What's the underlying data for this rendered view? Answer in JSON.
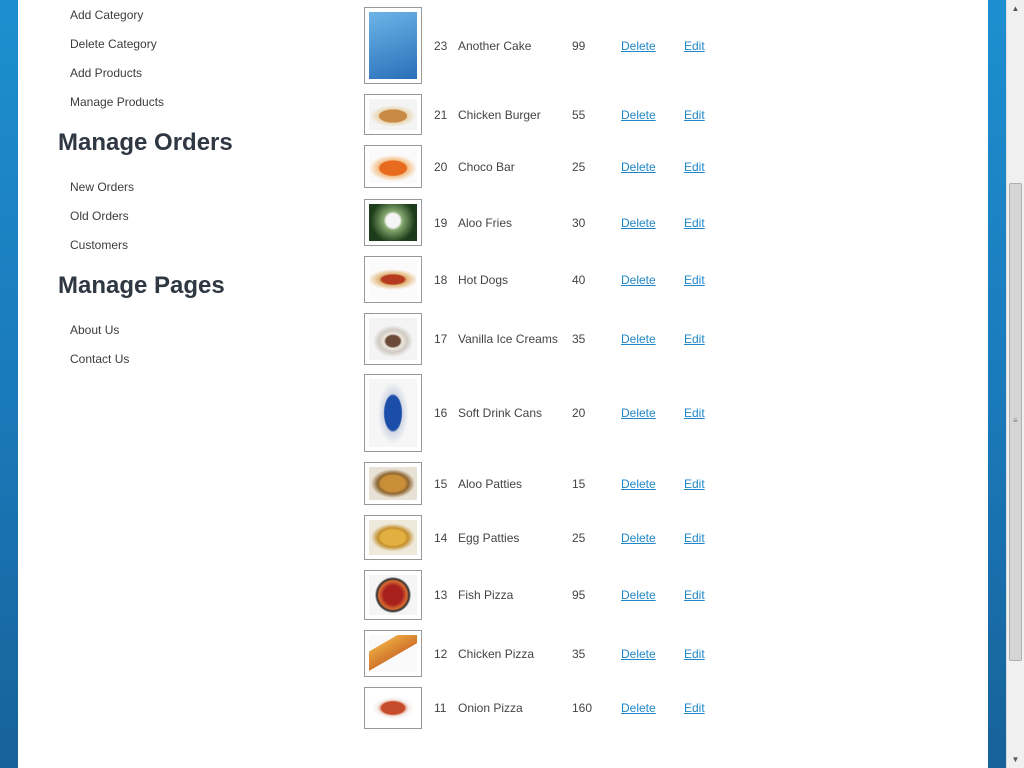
{
  "sidebar": {
    "menu1": [
      {
        "label": "Add Category"
      },
      {
        "label": "Delete Category"
      },
      {
        "label": "Add Products"
      },
      {
        "label": "Manage Products"
      }
    ],
    "orders_title": "Manage Orders",
    "orders": [
      {
        "label": "New Orders"
      },
      {
        "label": "Old Orders"
      },
      {
        "label": "Customers"
      }
    ],
    "pages_title": "Manage Pages",
    "pages": [
      {
        "label": "About Us"
      },
      {
        "label": "Contact Us"
      }
    ]
  },
  "products": [
    {
      "id": "23",
      "name": "Another Cake",
      "price": "99",
      "image": "book-cover",
      "delete_label": "Delete",
      "edit_label": "Edit"
    },
    {
      "id": "21",
      "name": "Chicken Burger",
      "price": "55",
      "image": "burger",
      "delete_label": "Delete",
      "edit_label": "Edit"
    },
    {
      "id": "20",
      "name": "Choco Bar",
      "price": "25",
      "image": "fries",
      "delete_label": "Delete",
      "edit_label": "Edit"
    },
    {
      "id": "19",
      "name": "Aloo Fries",
      "price": "30",
      "image": "flower",
      "delete_label": "Delete",
      "edit_label": "Edit"
    },
    {
      "id": "18",
      "name": "Hot Dogs",
      "price": "40",
      "image": "hotdog",
      "delete_label": "Delete",
      "edit_label": "Edit"
    },
    {
      "id": "17",
      "name": "Vanilla Ice Creams",
      "price": "35",
      "image": "ice-cream",
      "delete_label": "Delete",
      "edit_label": "Edit"
    },
    {
      "id": "16",
      "name": "Soft Drink Cans",
      "price": "20",
      "image": "soda-can",
      "delete_label": "Delete",
      "edit_label": "Edit"
    },
    {
      "id": "15",
      "name": "Aloo Patties",
      "price": "15",
      "image": "patty",
      "delete_label": "Delete",
      "edit_label": "Edit"
    },
    {
      "id": "14",
      "name": "Egg Patties",
      "price": "25",
      "image": "egg-patty",
      "delete_label": "Delete",
      "edit_label": "Edit"
    },
    {
      "id": "13",
      "name": "Fish Pizza",
      "price": "95",
      "image": "pizza",
      "delete_label": "Delete",
      "edit_label": "Edit"
    },
    {
      "id": "12",
      "name": "Chicken Pizza",
      "price": "35",
      "image": "pizza-slice",
      "delete_label": "Delete",
      "edit_label": "Edit"
    },
    {
      "id": "11",
      "name": "Onion Pizza",
      "price": "160",
      "image": "plate-pizza",
      "delete_label": "Delete",
      "edit_label": "Edit"
    }
  ],
  "colors": {
    "background": "#1a7fc1",
    "link": "#1f86c7",
    "heading": "#2f3842"
  }
}
